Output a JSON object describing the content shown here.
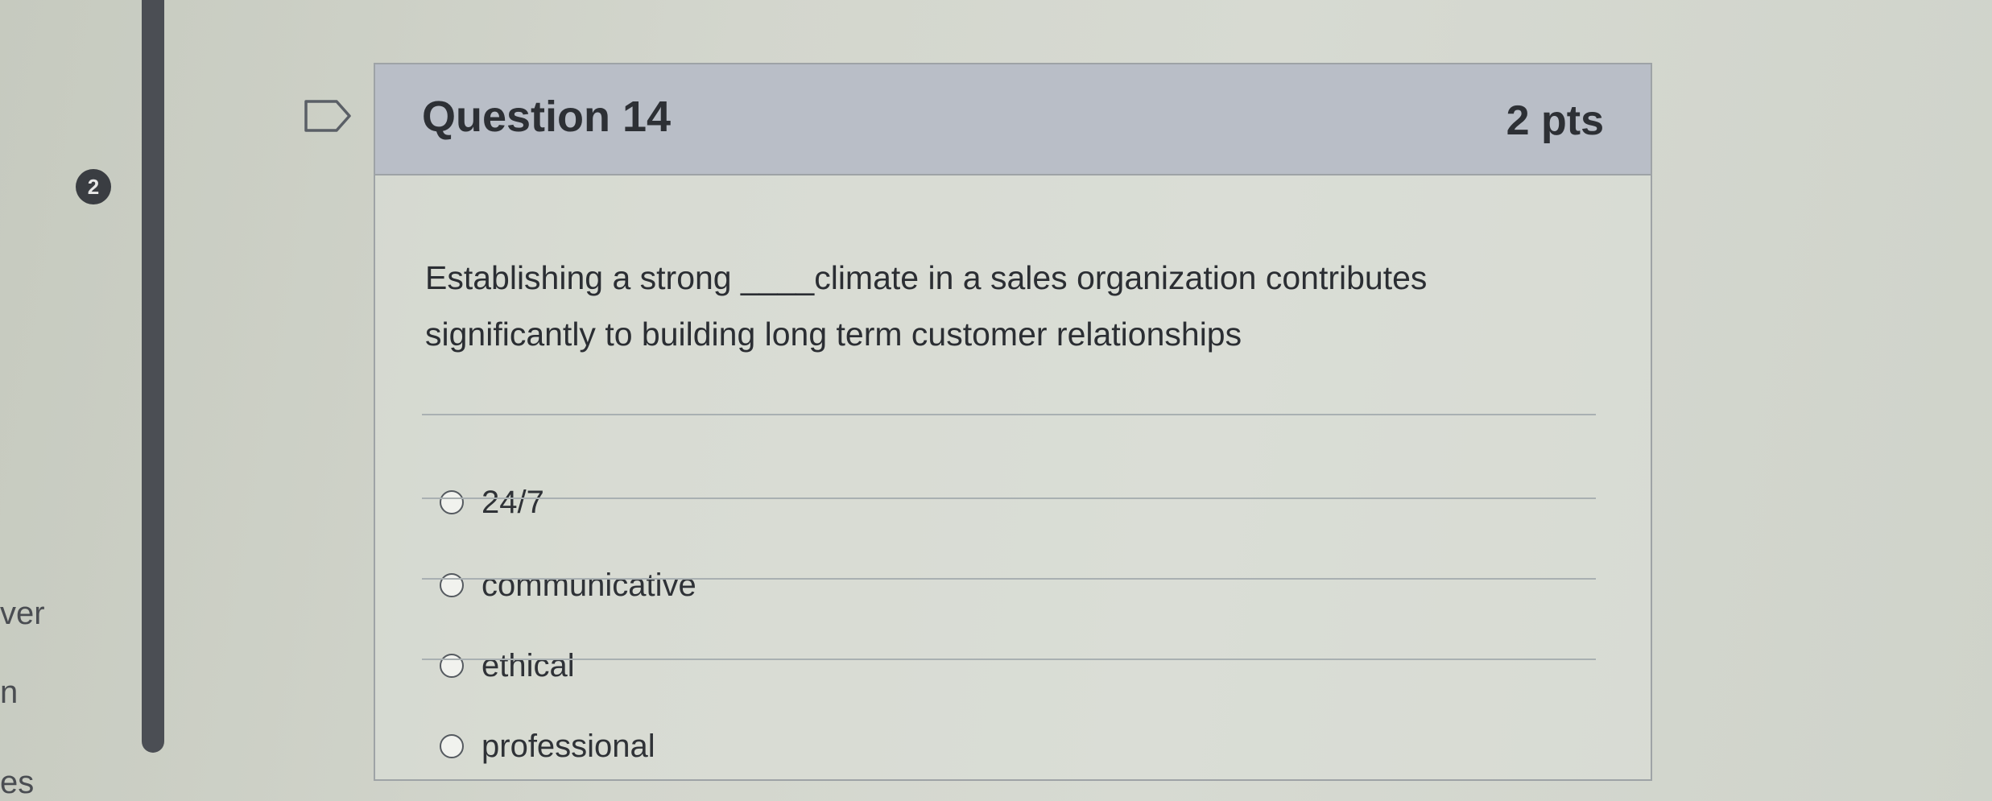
{
  "sidebar": {
    "fragments": [
      "ver",
      "n",
      "es"
    ],
    "badge": "2"
  },
  "question": {
    "title": "Question 14",
    "points": "2 pts",
    "text_line1": "Establishing a strong ____climate in a sales organization contributes",
    "text_line2": "significantly to building long term customer relationships",
    "answers": [
      {
        "label": "24/7",
        "selected": false
      },
      {
        "label": "communicative",
        "selected": false
      },
      {
        "label": "ethical",
        "selected": false
      },
      {
        "label": "professional",
        "selected": false
      }
    ]
  },
  "icons": {
    "flag": "flag-question-icon",
    "radio": "radio-button-icon"
  },
  "colors": {
    "header_bg": "#b9bec7",
    "scrollbar": "#4b4e54"
  }
}
